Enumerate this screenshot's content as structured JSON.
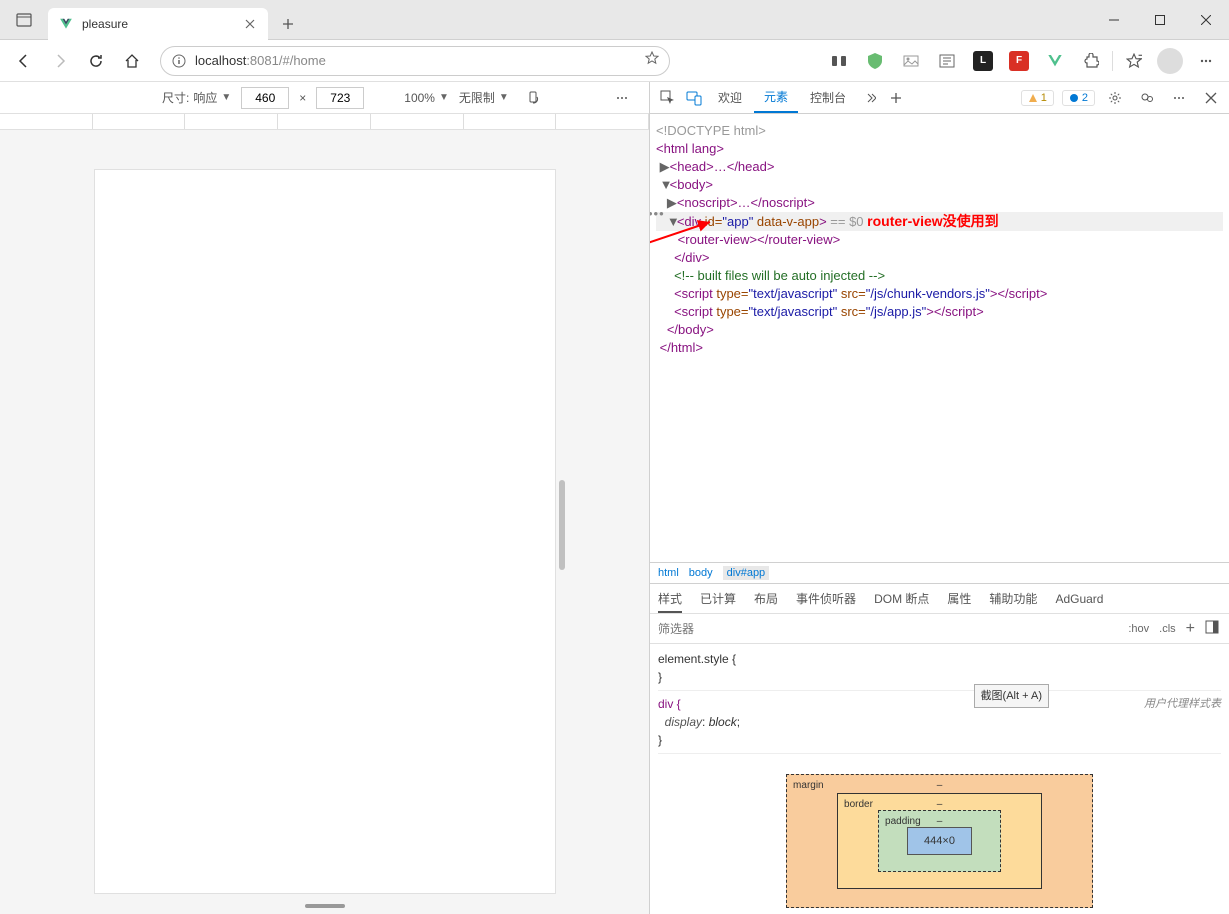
{
  "browser": {
    "tab_title": "pleasure",
    "url_host": "localhost",
    "url_port": ":8081",
    "url_path": "/#/home"
  },
  "device_toolbar": {
    "size_label": "尺寸:",
    "responsive_label": "响应",
    "width": "460",
    "times": "×",
    "height": "723",
    "zoom": "100%",
    "throttle": "无限制"
  },
  "devtools": {
    "tabs": {
      "welcome": "欢迎",
      "elements": "元素",
      "console": "控制台"
    },
    "warn_count": "1",
    "info_count": "2"
  },
  "dom": {
    "doctype": "<!DOCTYPE html>",
    "html_open": "<html lang>",
    "head": "<head>…</head>",
    "body_open": "<body>",
    "noscript": "<noscript>…</noscript>",
    "app_open_prefix": "<div ",
    "app_id_attr": "id=",
    "app_id_val": "\"app\"",
    "app_data_attr": " data-v-app",
    "app_open_suffix": ">",
    "eq0": " == $0",
    "router_view": "<router-view></router-view>",
    "div_close": "</div>",
    "comment": "<!-- built files will be auto injected -->",
    "script1_open": "<script ",
    "script1_type": "type=",
    "script1_type_val": "\"text/javascript\"",
    "script1_src": " src=",
    "script1_src_val": "\"/js/chunk-vendors.js\"",
    "script1_close": "></script>",
    "script2_src_val": "\"/js/app.js\"",
    "body_close": "</body>",
    "html_close": "</html>"
  },
  "annotation": "router-view没使用到",
  "breadcrumb": {
    "html": "html",
    "body": "body",
    "app": "div#app"
  },
  "styles_tabs": {
    "styles": "样式",
    "computed": "已计算",
    "layout": "布局",
    "listeners": "事件侦听器",
    "dom_breakpoints": "DOM 断点",
    "properties": "属性",
    "accessibility": "辅助功能",
    "adguard": "AdGuard"
  },
  "filter_placeholder": "筛选器",
  "filter_tools": {
    "hov": ":hov",
    "cls": ".cls",
    "plus": "+"
  },
  "css": {
    "element_style": "element.style {",
    "close": "}",
    "div_sel": "div {",
    "display_prop": "display",
    "display_val": "block",
    "semicolon": ";",
    "source": "用户代理样式表",
    "hint": "截图(Alt + A)"
  },
  "box_model": {
    "margin": "margin",
    "border": "border",
    "padding": "padding",
    "content": "444×0",
    "dash": "–"
  }
}
